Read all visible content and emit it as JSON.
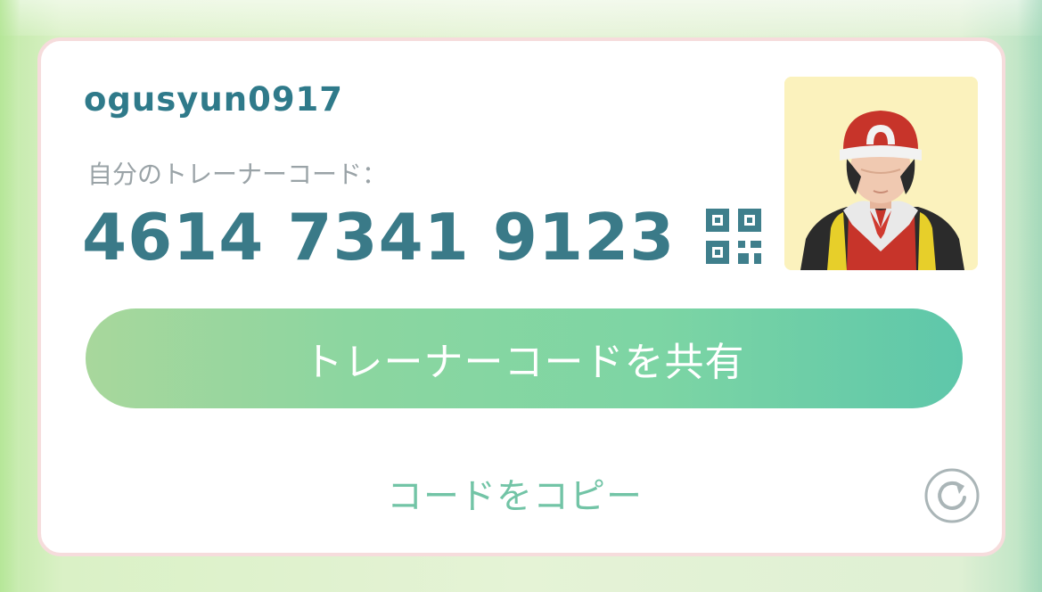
{
  "profile": {
    "username": "ogusyun0917"
  },
  "trainer_code": {
    "label": "自分のトレーナーコード：",
    "value": "4614 7341 9123"
  },
  "actions": {
    "share_label": "トレーナーコードを共有",
    "copy_label": "コードをコピー"
  },
  "icons": {
    "qr": "qr-code-icon",
    "refresh": "refresh-icon",
    "avatar": "trainer-avatar"
  },
  "colors": {
    "code_text": "#3a7a88",
    "share_gradient_start": "#a8d79c",
    "share_gradient_end": "#5ec7aa",
    "copy_text": "#72c4a6",
    "card_border": "#f6dcdc"
  }
}
